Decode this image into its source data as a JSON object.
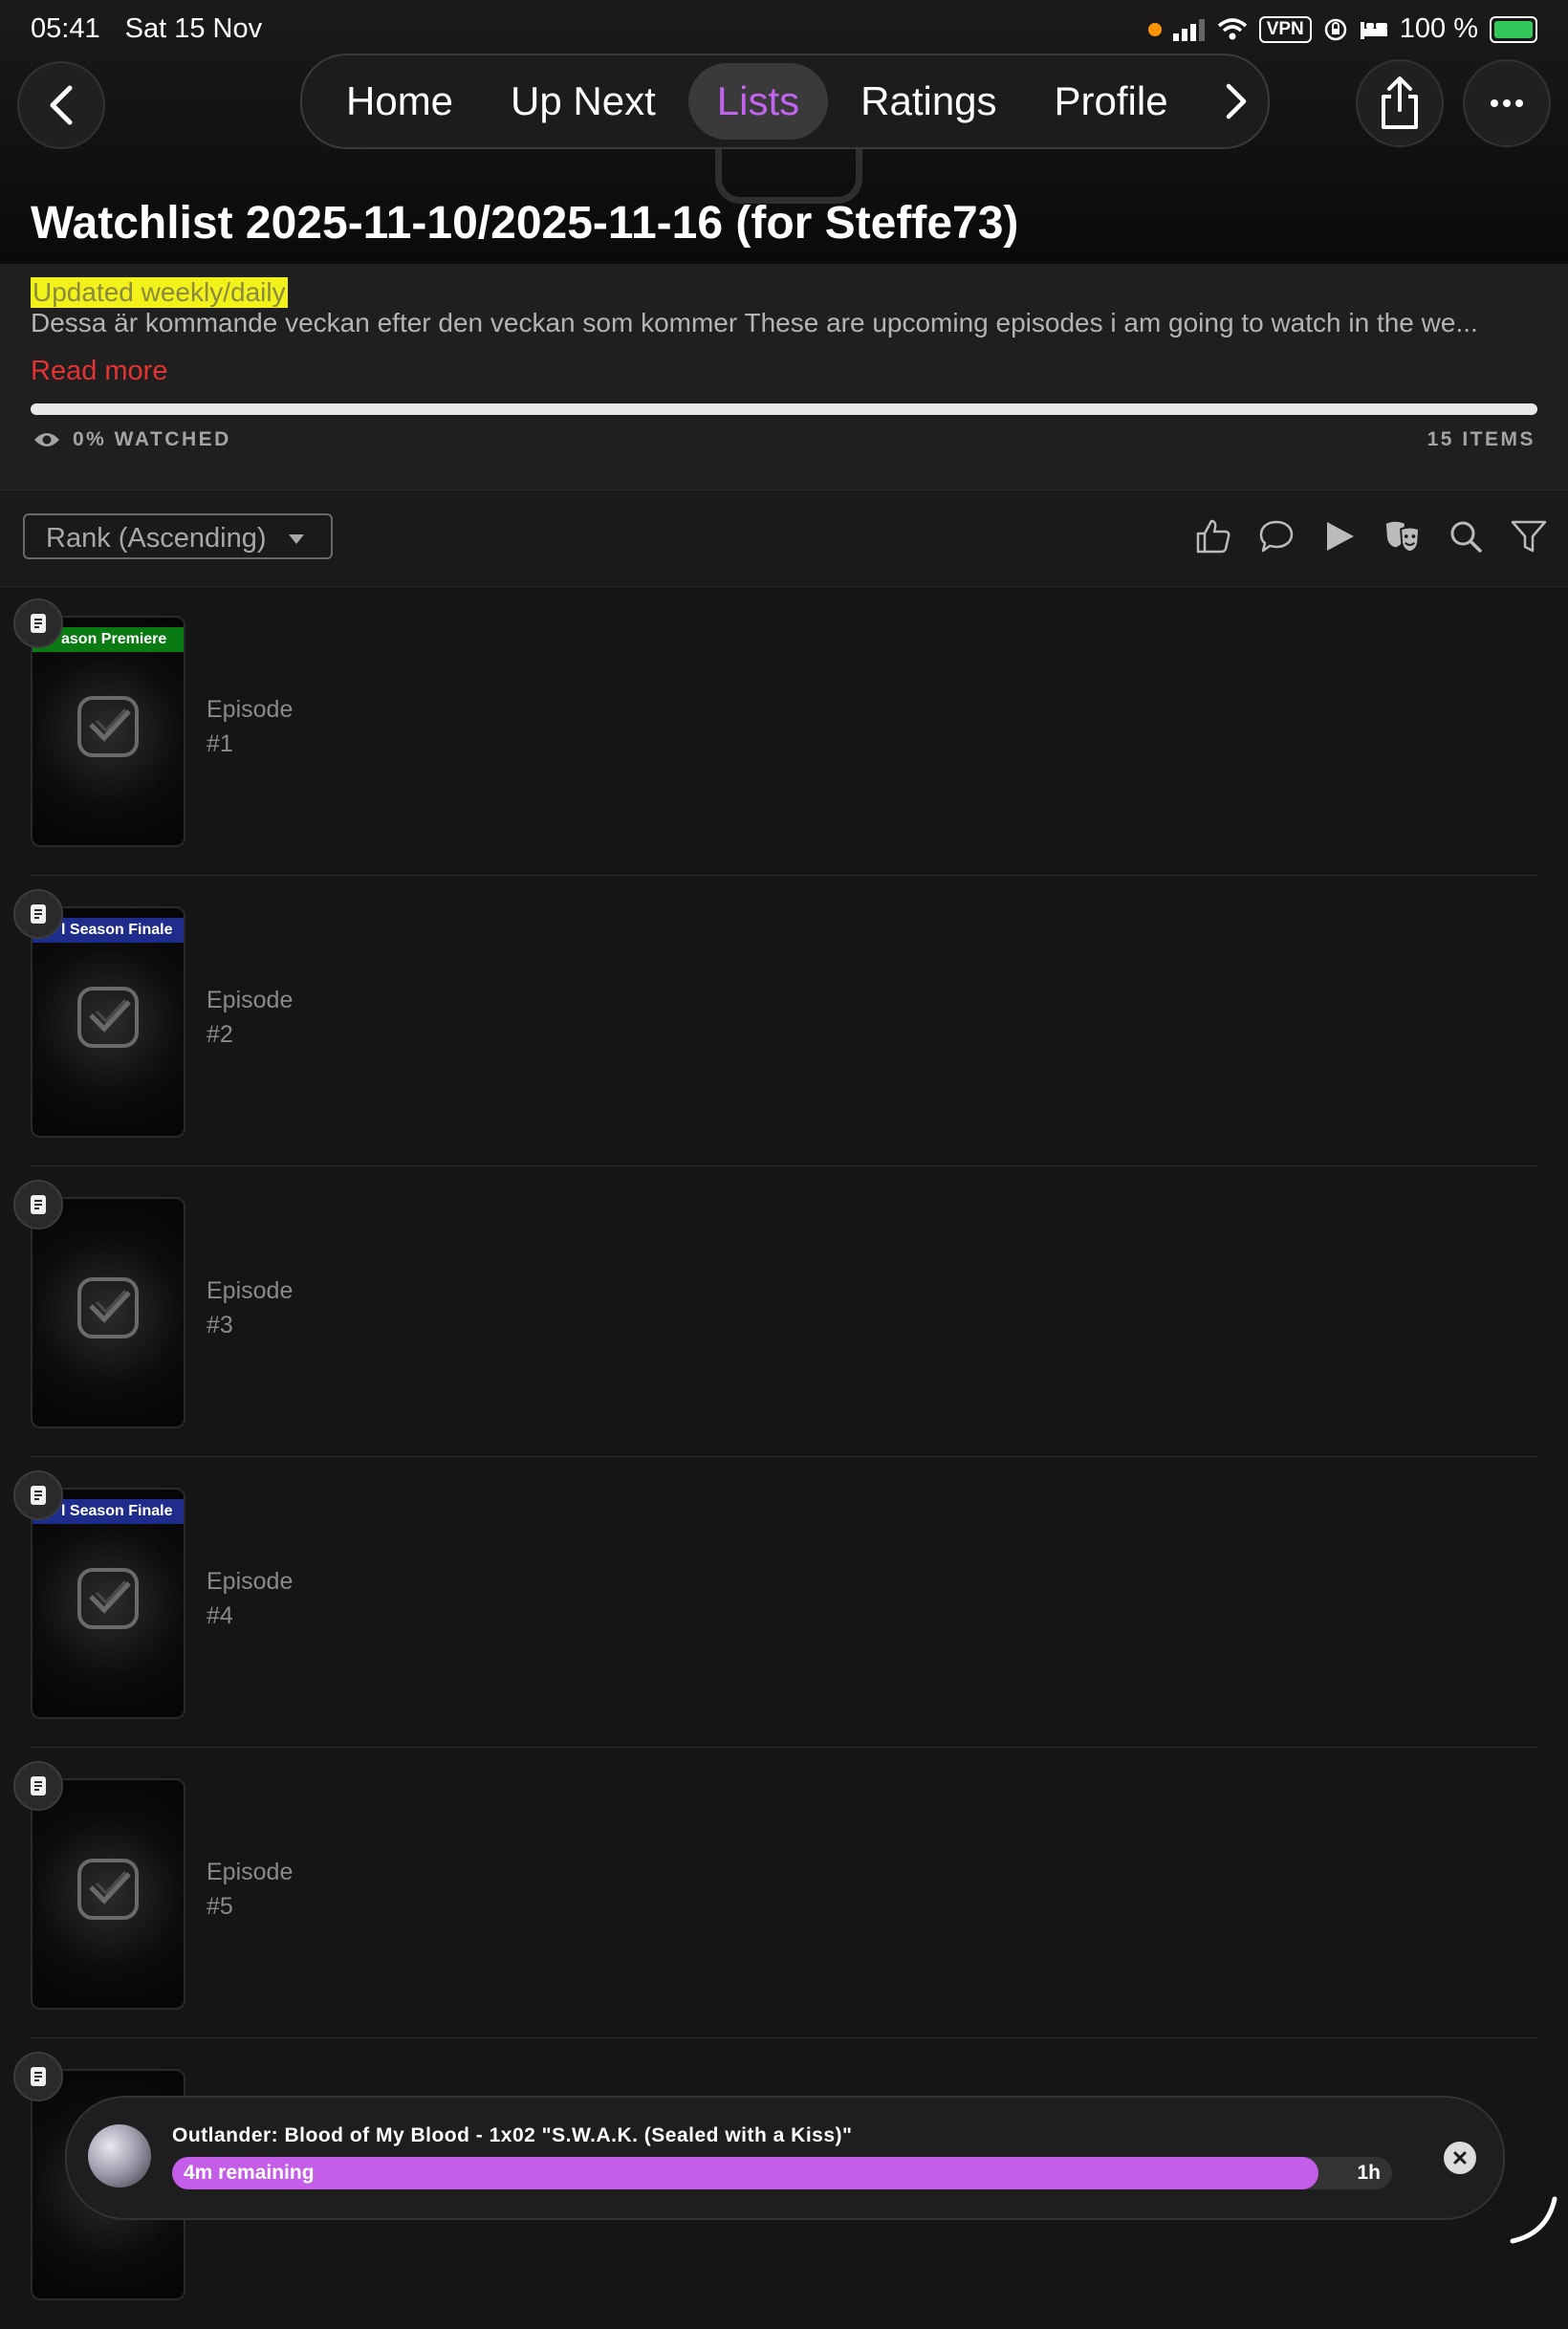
{
  "status_bar": {
    "time": "05:41",
    "date": "Sat 15 Nov",
    "vpn": "VPN",
    "battery": "100 %"
  },
  "nav": {
    "tabs": [
      {
        "label": "Home"
      },
      {
        "label": "Up Next"
      },
      {
        "label": "Lists"
      },
      {
        "label": "Ratings"
      },
      {
        "label": "Profile"
      }
    ],
    "active": "Lists"
  },
  "header": {
    "title": "Watchlist 2025-11-10/2025-11-16 (for Steffe73)"
  },
  "description": {
    "badge": "Updated weekly/daily",
    "text": "Dessa är kommande veckan efter den veckan som kommer  These are upcoming episodes i am going to watch in the we...",
    "read_more": "Read more"
  },
  "progress": {
    "watched_label": "0% WATCHED",
    "watched_fraction": 0,
    "items_label": "15 ITEMS"
  },
  "toolbar": {
    "sort_label": "Rank (Ascending)"
  },
  "episodes": [
    {
      "ribbon": "ason Premiere",
      "ribbon_color": "#0a7b12",
      "label": "Episode",
      "number": "#1"
    },
    {
      "ribbon": "l Season Finale",
      "ribbon_color": "#1e2c8c",
      "label": "Episode",
      "number": "#2"
    },
    {
      "ribbon": "",
      "ribbon_color": "",
      "label": "Episode",
      "number": "#3"
    },
    {
      "ribbon": "l Season Finale",
      "ribbon_color": "#1e2c8c",
      "label": "Episode",
      "number": "#4"
    },
    {
      "ribbon": "",
      "ribbon_color": "",
      "label": "Episode",
      "number": "#5"
    }
  ],
  "player": {
    "title": "Outlander: Blood of My Blood - 1x02 \"S.W.A.K. (Sealed with a Kiss)\"",
    "remaining": "4m remaining",
    "duration": "1h",
    "progress_fraction": 0.94
  },
  "colors": {
    "accent": "#c264ee",
    "read_more": "#e53232",
    "badge_bg": "#f2f21a",
    "premiere": "#0a7b12",
    "finale": "#1e2c8c",
    "player_fill": "#c45ee8"
  }
}
